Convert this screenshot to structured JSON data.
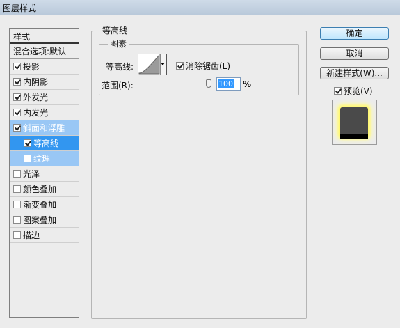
{
  "window": {
    "title": "图层样式"
  },
  "list": {
    "header": "样式",
    "default_item": "混合选项:默认",
    "items": [
      {
        "label": "投影",
        "checked": true
      },
      {
        "label": "内阴影",
        "checked": true
      },
      {
        "label": "外发光",
        "checked": true
      },
      {
        "label": "内发光",
        "checked": true
      },
      {
        "label": "斜面和浮雕",
        "checked": true
      },
      {
        "label": "等高线",
        "checked": true
      },
      {
        "label": "纹理",
        "checked": false
      },
      {
        "label": "光泽",
        "checked": false
      },
      {
        "label": "颜色叠加",
        "checked": false
      },
      {
        "label": "渐变叠加",
        "checked": false
      },
      {
        "label": "图案叠加",
        "checked": false
      },
      {
        "label": "描边",
        "checked": false
      }
    ]
  },
  "panel": {
    "group_title": "等高线",
    "subgroup_title": "图素",
    "contour_label": "等高线:",
    "antialias_label": "消除锯齿(L)",
    "antialias_checked": true,
    "range_label": "范围(R):",
    "range_value": "100",
    "range_unit": "%"
  },
  "buttons": {
    "ok": "确定",
    "cancel": "取消",
    "new_style": "新建样式(W)...",
    "preview_label": "预览(V)",
    "preview_checked": true
  }
}
